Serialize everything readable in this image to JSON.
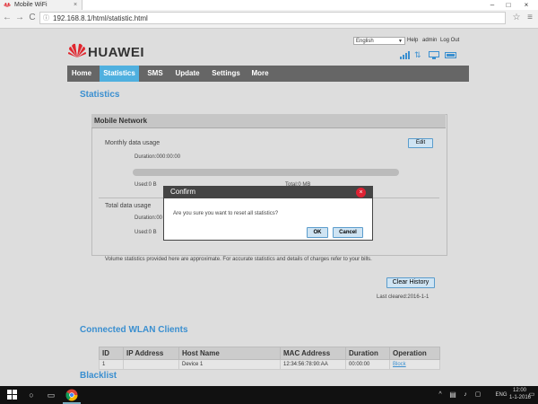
{
  "browser": {
    "tab_title": "Mobile WiFi",
    "tab_close": "×",
    "minimize": "–",
    "maximize": "□",
    "close": "×",
    "back": "←",
    "forward": "→",
    "reload": "C",
    "url": "192.168.8.1/html/statistic.html",
    "star": "☆",
    "menu": "≡"
  },
  "header": {
    "brand": "HUAWEI",
    "language": "English",
    "help": "Help",
    "user": "admin",
    "logout": "Log Out"
  },
  "nav": {
    "items": [
      "Home",
      "Statistics",
      "SMS",
      "Update",
      "Settings",
      "More"
    ],
    "active": "Statistics"
  },
  "statistics": {
    "title": "Statistics",
    "panel_title": "Mobile Network",
    "monthly_label": "Monthly data usage",
    "edit_button": "Edit",
    "monthly_duration": "Duration:000:00:00",
    "monthly_used": "Used:0 B",
    "monthly_total": "Total:0 MB",
    "monthly_fraction": 0,
    "total_label": "Total data usage",
    "total_duration": "Duration:00",
    "total_used": "Used:0 B",
    "note": "Volume statistics provided here are approximate. For accurate statistics and details of charges refer to your bills.",
    "clear_button": "Clear History",
    "last_cleared": "Last cleared:2016-1-1"
  },
  "wlan": {
    "title": "Connected WLAN Clients",
    "columns": [
      "ID",
      "IP Address",
      "Host Name",
      "MAC Address",
      "Duration",
      "Operation"
    ],
    "rows": [
      [
        "1",
        "",
        "Device 1",
        "12:34:56:78:90:AA",
        "00:00:00",
        "Block"
      ]
    ]
  },
  "blacklist": {
    "title": "Blacklist"
  },
  "dialog": {
    "title": "Confirm",
    "close": "×",
    "message": "Are you sure you want to reset all statistics?",
    "ok": "OK",
    "cancel": "Cancel"
  },
  "taskbar": {
    "lang": "ENG",
    "time": "12:00",
    "date": "1-1-2016"
  },
  "colors": {
    "accent": "#4fb0df",
    "nav_bg": "#666666",
    "dialog_header": "#444444",
    "brand_red": "#e0262e"
  }
}
